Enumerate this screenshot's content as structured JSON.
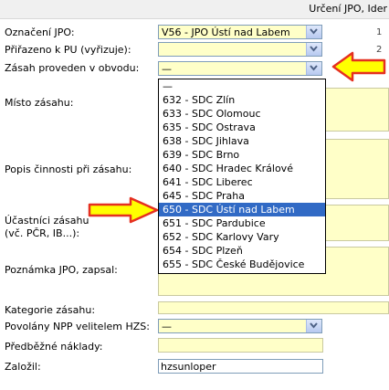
{
  "header": {
    "title": "Určení JPO, Ider"
  },
  "labels": {
    "oznaceni_jpo": "Označení JPO:",
    "prirazeno_pu": "Přiřazeno k PU (vyřizuje):",
    "zasah_obvod": "Zásah proveden v obvodu:",
    "misto_zasahu": "Místo zásahu:",
    "popis_cinnosti": "Popis činnosti při zásahu:",
    "ucastnici_1": "Účastníci zásahu",
    "ucastnici_2": "(vč. PČR, IB...):",
    "poznamka": "Poznámka JPO, zapsal:",
    "kategorie": "Kategorie zásahu:",
    "povolany": "Povolány NPP velitelem HZS:",
    "predbezne": "Předběžné náklady:",
    "zalozil": "Založil:"
  },
  "fields": {
    "oznaceni_jpo": "V56 - JPO Ústí nad Labem",
    "prirazeno_pu": "",
    "zasah_obvod": "—",
    "povolany": "—",
    "zalozil": "hzsunloper"
  },
  "right_marks": {
    "row1": "1",
    "row2": "2",
    "row3": "2"
  },
  "dropdown": {
    "options": [
      "—",
      "632 - SDC Zlín",
      "633 - SDC Olomouc",
      "635 - SDC Ostrava",
      "638 - SDC Jihlava",
      "639 - SDC Brno",
      "640 - SDC Hradec Králové",
      "641 - SDC Liberec",
      "645 - SDC Praha",
      "650 - SDC Ústí nad Labem",
      "651 - SDC Pardubice",
      "652 - SDC Karlovy Vary",
      "654 - SDC Plzeň",
      "655 - SDC České Budějovice"
    ],
    "selected_index": 9
  },
  "colors": {
    "field_bg": "#ffffc8",
    "highlight": "#316ac5",
    "arrow_fill": "#ffff00",
    "arrow_stroke": "#e53020"
  }
}
